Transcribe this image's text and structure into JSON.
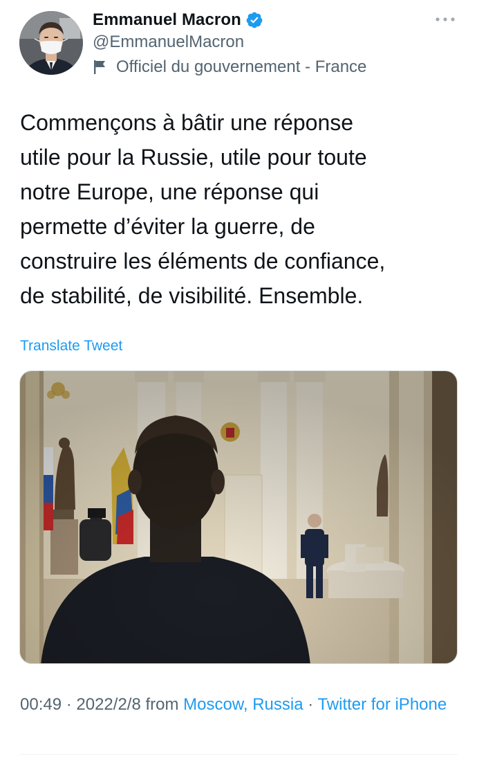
{
  "author": {
    "name": "Emmanuel Macron",
    "handle": "@EmmanuelMacron",
    "label": "Officiel du gouvernement - France",
    "verified": true,
    "avatar_icon": "avatar-photo"
  },
  "tweet": {
    "text": "Commençons à bâtir une réponse\nutile pour la Russie, utile pour toute\nnotre Europe, une réponse qui\npermette d’éviter la guerre, de\nconstruire les éléments de confiance,\nde stabilité, de visibilité. Ensemble.",
    "translate_label": "Translate Tweet"
  },
  "meta": {
    "time": "00:49",
    "separator": " · ",
    "date": "2022/2/8",
    "from_label": " from ",
    "location": "Moscow, Russia",
    "separator2": " · ",
    "source": "Twitter for iPhone"
  },
  "icons": {
    "more": "more-horizontal-icon",
    "verified": "verified-badge-icon",
    "label": "flag-icon"
  },
  "colors": {
    "accent": "#1d9bf0",
    "secondary_text": "#536471",
    "primary_text": "#0f1419"
  }
}
